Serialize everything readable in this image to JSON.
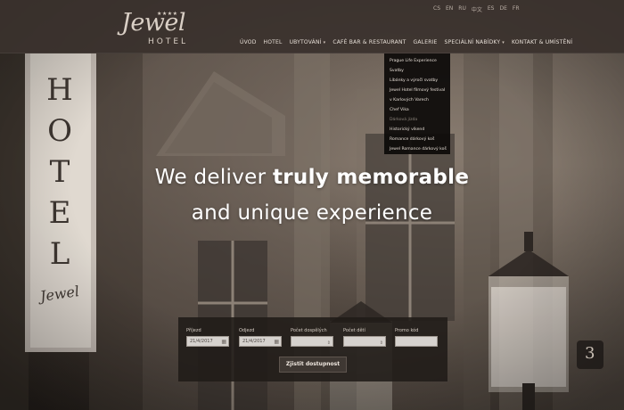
{
  "logo": {
    "stars": "★★★★",
    "script": "Jewel",
    "caps": "HOTEL"
  },
  "languages": [
    "CS",
    "EN",
    "RU",
    "中文",
    "ES",
    "DE",
    "FR"
  ],
  "nav": [
    {
      "label": "ÚVOD",
      "has_caret": false
    },
    {
      "label": "HOTEL",
      "has_caret": false
    },
    {
      "label": "UBYTOVÁNÍ",
      "has_caret": true
    },
    {
      "label": "CAFÉ BAR & RESTAURANT",
      "has_caret": false
    },
    {
      "label": "GALERIE",
      "has_caret": false
    },
    {
      "label": "SPECIÁLNÍ NABÍDKY",
      "has_caret": true
    },
    {
      "label": "KONTAKT & UMÍSTĚNÍ",
      "has_caret": false
    }
  ],
  "dropdown": [
    {
      "label": "Prague Life Experience",
      "muted": false
    },
    {
      "label": "Svatby",
      "muted": false
    },
    {
      "label": "Líbánky a výročí svatby",
      "muted": false
    },
    {
      "label": "Jewel Hotel filmový festival",
      "muted": false
    },
    {
      "label": "v Karlových Varech",
      "muted": false
    },
    {
      "label": "Chef Vika",
      "muted": false
    },
    {
      "label": "Dárková jízda",
      "muted": true
    },
    {
      "label": "Historický víkend",
      "muted": false
    },
    {
      "label": "Romance dárkový koš",
      "muted": false
    },
    {
      "label": "Jewel Romance dárkový koš",
      "muted": false
    }
  ],
  "hero": {
    "headline_light": "We deliver ",
    "headline_bold": "truly memorable",
    "subline": "and unique experience",
    "sign_letters": [
      "H",
      "O",
      "T",
      "E",
      "L"
    ],
    "sign_script": "Jewel",
    "house_number": "3"
  },
  "booking": {
    "arrival_label": "Příjezd",
    "arrival_value": "21/4/2017",
    "departure_label": "Odjezd",
    "departure_value": "21/4/2017",
    "adults_label": "Počet dospělých",
    "children_label": "Počet dětí",
    "promo_label": "Promo kód",
    "submit_label": "Zjistit dostupnost"
  },
  "colors": {
    "topbar": "#3a322d",
    "dropdown_bg": "#0c0a09",
    "booking_bg": "#201b18",
    "text_light": "#e8e0d8"
  },
  "icons": {
    "calendar": "calendar-icon",
    "select": "select-arrows-icon"
  }
}
